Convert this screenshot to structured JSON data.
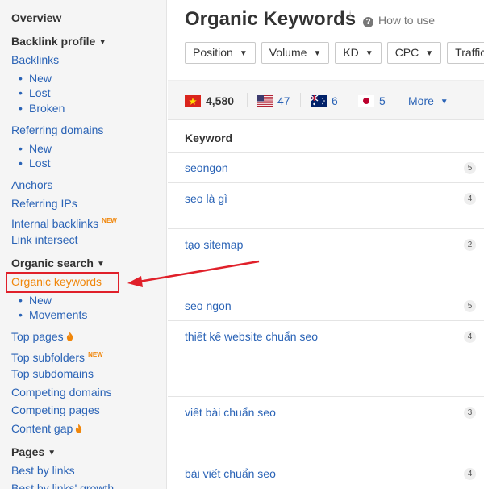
{
  "sidebar": {
    "overview": "Overview",
    "backlink_profile": "Backlink profile",
    "backlinks": "Backlinks",
    "backlinks_sub": [
      "New",
      "Lost",
      "Broken"
    ],
    "referring_domains": "Referring domains",
    "referring_domains_sub": [
      "New",
      "Lost"
    ],
    "anchors": "Anchors",
    "referring_ips": "Referring IPs",
    "internal_backlinks": "Internal backlinks",
    "new_badge": "NEW",
    "link_intersect": "Link intersect",
    "organic_search": "Organic search",
    "organic_keywords": "Organic keywords",
    "organic_keywords_sub": [
      "New",
      "Movements"
    ],
    "top_pages": "Top pages",
    "top_subfolders": "Top subfolders",
    "top_subdomains": "Top subdomains",
    "competing_domains": "Competing domains",
    "competing_pages": "Competing pages",
    "content_gap": "Content gap",
    "pages": "Pages",
    "best_by_links": "Best by links",
    "best_by_links_growth": "Best by links' growth"
  },
  "header": {
    "title": "Organic Keywords",
    "info": "i",
    "how_to_use": "How to use"
  },
  "filters": [
    "Position",
    "Volume",
    "KD",
    "CPC",
    "Traffic"
  ],
  "countries": [
    {
      "flag": "vietnam-flag",
      "count": "4,580"
    },
    {
      "flag": "usa-flag",
      "count": "47"
    },
    {
      "flag": "australia-flag",
      "count": "6"
    },
    {
      "flag": "japan-flag",
      "count": "5"
    }
  ],
  "more_label": "More",
  "table": {
    "column_keyword": "Keyword",
    "rows": [
      {
        "keyword": "seongon",
        "position": "5"
      },
      {
        "keyword": "seo là gì",
        "position": "4"
      },
      {
        "keyword": "tạo sitemap",
        "position": "2"
      },
      {
        "keyword": "seo ngon",
        "position": "5"
      },
      {
        "keyword": "thiết kế website chuẩn seo",
        "position": "4"
      },
      {
        "keyword": "viết bài chuẩn seo",
        "position": "3"
      },
      {
        "keyword": "bài viết chuẩn seo",
        "position": "4"
      }
    ]
  },
  "colors": {
    "link": "#2a63b6",
    "accent_orange": "#f0860a",
    "highlight_red": "#e0202a"
  }
}
